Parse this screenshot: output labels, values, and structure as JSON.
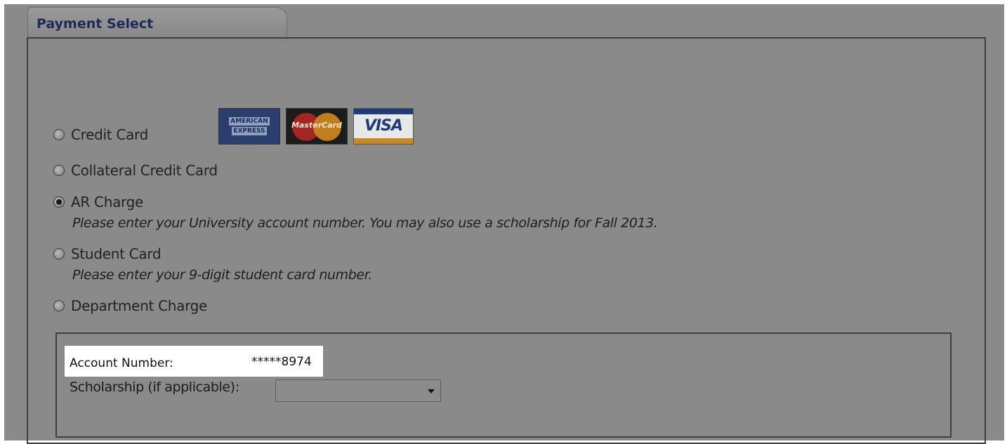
{
  "tab": {
    "title": "Payment Select"
  },
  "options": [
    {
      "label": "Credit Card",
      "selected": false
    },
    {
      "label": "Collateral Credit Card",
      "selected": false
    },
    {
      "label": "AR Charge",
      "selected": true,
      "note": "Please enter your University account number. You may also use a scholarship for Fall 2013."
    },
    {
      "label": "Student Card",
      "selected": false,
      "note": "Please enter your 9-digit student card number."
    },
    {
      "label": "Department Charge",
      "selected": false
    }
  ],
  "cards": {
    "amex_line1": "AMERICAN",
    "amex_line2": "EXPRESS",
    "mastercard": "MasterCard",
    "visa": "VISA"
  },
  "account": {
    "label": "Account Number:",
    "value": "*****8974"
  },
  "scholarship": {
    "label": "Scholarship (if applicable):",
    "selected_value": ""
  },
  "colors": {
    "background": "#8a8a8a",
    "tab_title": "#1c2a5a",
    "highlight": "#ffffff"
  }
}
